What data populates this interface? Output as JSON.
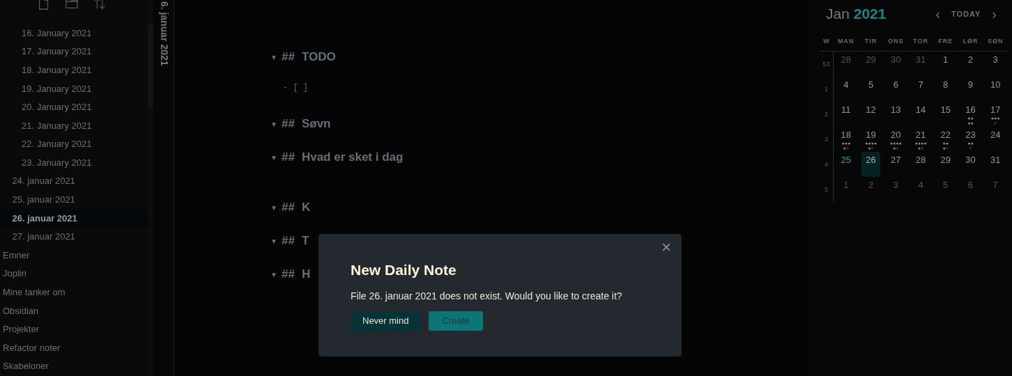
{
  "sidebar": {
    "toolbar": [
      {
        "kind": "new-note"
      },
      {
        "kind": "new-folder"
      },
      {
        "kind": "sort"
      }
    ],
    "file_tree": [
      {
        "children": [
          {
            "children": [
              {
                "label": "16. January 2021",
                "selected": false
              },
              {
                "label": "17. January 2021",
                "selected": false
              },
              {
                "label": "18. January 2021",
                "selected": false
              },
              {
                "label": "19. January 2021",
                "selected": false
              },
              {
                "label": "20. January 2021",
                "selected": false
              },
              {
                "label": "21. January 2021",
                "selected": false
              },
              {
                "label": "22. January 2021",
                "selected": false
              },
              {
                "label": "23. January 2021",
                "selected": false
              }
            ]
          },
          {
            "label": "24. januar 2021",
            "selected": false
          },
          {
            "label": "25. januar 2021",
            "selected": false
          },
          {
            "label": "26. januar 2021",
            "selected": true
          },
          {
            "label": "27. januar 2021",
            "selected": false
          }
        ]
      },
      {
        "label": "Emner",
        "selected": false
      },
      {
        "label": "Joplin",
        "selected": false
      },
      {
        "label": "Mine tanker om",
        "selected": false
      },
      {
        "label": "Obsidian",
        "selected": false
      },
      {
        "label": "Projekter",
        "selected": false
      },
      {
        "label": "Refactor noter",
        "selected": false
      },
      {
        "label": "Skabeloner",
        "selected": false
      }
    ]
  },
  "note_tab": {
    "title": "6. januar 2021"
  },
  "editor": {
    "lines": [
      {
        "kind": "heading",
        "fold": "▼",
        "marker": "##",
        "text": "TODO"
      },
      {
        "kind": "code",
        "text": "- [ ]"
      },
      {
        "kind": "heading",
        "fold": "▼",
        "marker": "##",
        "text": "Søvn"
      },
      {
        "kind": "heading",
        "fold": "▼",
        "marker": "##",
        "text": "Hvad er sket i dag"
      },
      {
        "kind": "heading",
        "fold": "▼",
        "marker": "##",
        "text": "K"
      },
      {
        "kind": "heading",
        "fold": "▼",
        "marker": "##",
        "text": "T"
      },
      {
        "kind": "heading",
        "fold": "▼",
        "marker": "##",
        "text": "H"
      }
    ]
  },
  "calendar": {
    "month": "Jan",
    "year": "2021",
    "prev": "‹",
    "today_button": "TODAY",
    "next": "›",
    "columns": [
      "W",
      "MAN",
      "TIR",
      "ONS",
      "TOR",
      "FRE",
      "LØR",
      "SØN"
    ],
    "weeks": [
      {
        "week": "53",
        "days": [
          {
            "day": "28",
            "outside": true,
            "today": false,
            "selected": false
          },
          {
            "day": "29",
            "outside": true,
            "today": false,
            "selected": false
          },
          {
            "day": "30",
            "outside": true,
            "today": false,
            "selected": false
          },
          {
            "day": "31",
            "outside": true,
            "today": false,
            "selected": false
          },
          {
            "day": "1",
            "outside": false,
            "today": false,
            "selected": false
          },
          {
            "day": "2",
            "outside": false,
            "today": false,
            "selected": false
          },
          {
            "day": "3",
            "outside": false,
            "today": false,
            "selected": false
          }
        ]
      },
      {
        "week": "1",
        "days": [
          {
            "day": "4",
            "outside": false,
            "today": false,
            "selected": false
          },
          {
            "day": "5",
            "outside": false,
            "today": false,
            "selected": false
          },
          {
            "day": "6",
            "outside": false,
            "today": false,
            "selected": false
          },
          {
            "day": "7",
            "outside": false,
            "today": false,
            "selected": false
          },
          {
            "day": "8",
            "outside": false,
            "today": false,
            "selected": false
          },
          {
            "day": "9",
            "outside": false,
            "today": false,
            "selected": false
          },
          {
            "day": "10",
            "outside": false,
            "today": false,
            "selected": false
          }
        ]
      },
      {
        "week": "2",
        "days": [
          {
            "day": "11",
            "outside": false,
            "today": false,
            "selected": false
          },
          {
            "day": "12",
            "outside": false,
            "today": false,
            "selected": false
          },
          {
            "day": "13",
            "outside": false,
            "today": false,
            "selected": false
          },
          {
            "day": "14",
            "outside": false,
            "today": false,
            "selected": false
          },
          {
            "day": "15",
            "outside": false,
            "today": false,
            "selected": false
          },
          {
            "day": "16",
            "outside": false,
            "today": false,
            "selected": false,
            "dots": [
              "●●",
              "●●"
            ]
          },
          {
            "day": "17",
            "outside": false,
            "today": false,
            "selected": false,
            "dots": [
              "●●●",
              "○"
            ]
          }
        ]
      },
      {
        "week": "3",
        "days": [
          {
            "day": "18",
            "outside": false,
            "today": false,
            "selected": false,
            "dots": [
              "●●●",
              "●○"
            ]
          },
          {
            "day": "19",
            "outside": false,
            "today": false,
            "selected": false,
            "dots": [
              "●●●●",
              "●○"
            ]
          },
          {
            "day": "20",
            "outside": false,
            "today": false,
            "selected": false,
            "dots": [
              "●●●●",
              "●○"
            ]
          },
          {
            "day": "21",
            "outside": false,
            "today": false,
            "selected": false,
            "dots": [
              "●●●●",
              "●○"
            ]
          },
          {
            "day": "22",
            "outside": false,
            "today": false,
            "selected": false,
            "dots": [
              "●●",
              "●○"
            ]
          },
          {
            "day": "23",
            "outside": false,
            "today": false,
            "selected": false,
            "dots": [
              "●●",
              "○"
            ]
          },
          {
            "day": "24",
            "outside": false,
            "today": false,
            "selected": false
          }
        ]
      },
      {
        "week": "4",
        "days": [
          {
            "day": "25",
            "outside": false,
            "today": true,
            "selected": false
          },
          {
            "day": "26",
            "outside": false,
            "today": false,
            "selected": true
          },
          {
            "day": "27",
            "outside": false,
            "today": false,
            "selected": false
          },
          {
            "day": "28",
            "outside": false,
            "today": false,
            "selected": false
          },
          {
            "day": "29",
            "outside": false,
            "today": false,
            "selected": false
          },
          {
            "day": "30",
            "outside": false,
            "today": false,
            "selected": false
          },
          {
            "day": "31",
            "outside": false,
            "today": false,
            "selected": false
          }
        ]
      },
      {
        "week": "5",
        "days": [
          {
            "day": "1",
            "outside": true,
            "today": false,
            "selected": false
          },
          {
            "day": "2",
            "outside": true,
            "today": false,
            "selected": false
          },
          {
            "day": "3",
            "outside": true,
            "today": false,
            "selected": false
          },
          {
            "day": "4",
            "outside": true,
            "today": false,
            "selected": false
          },
          {
            "day": "5",
            "outside": true,
            "today": false,
            "selected": false
          },
          {
            "day": "6",
            "outside": true,
            "today": false,
            "selected": false
          },
          {
            "day": "7",
            "outside": true,
            "today": false,
            "selected": false
          }
        ]
      }
    ]
  },
  "dialog": {
    "close": "×",
    "title": "New Daily Note",
    "message": "File 26. januar 2021 does not exist. Would you like to create it?",
    "buttons": [
      {
        "kind": "secondary",
        "label": "Never mind"
      },
      {
        "kind": "primary",
        "label": "Create"
      }
    ]
  }
}
